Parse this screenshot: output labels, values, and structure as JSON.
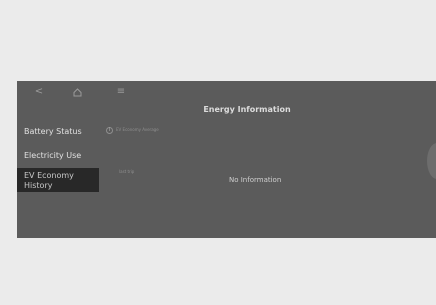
{
  "colors": {
    "page_bg": "#ebebeb",
    "screen_bg": "#5b5b5b",
    "active_menu_bg": "#282828"
  },
  "status_bar": {
    "back_icon": "chevron-left-icon",
    "home_icon": "home-icon",
    "menu_icon": "menu-icon"
  },
  "header": {
    "title": "Energy Information"
  },
  "sidebar": {
    "items": [
      {
        "label": "Battery Status",
        "active": false
      },
      {
        "label": "Electricity Use",
        "active": false
      },
      {
        "label": "EV Economy History",
        "active": true
      }
    ]
  },
  "main": {
    "legend_text": "EV Economy Average",
    "range_label": "last trip",
    "empty_message": "No Information"
  }
}
